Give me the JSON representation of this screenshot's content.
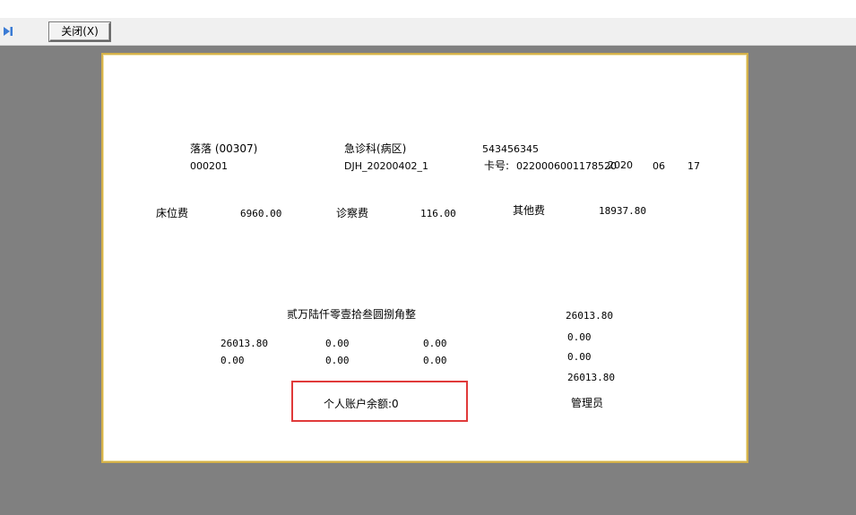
{
  "toolbar": {
    "close_label": "关闭(X)"
  },
  "patient": {
    "name": "落落 (00307)",
    "department": "急诊科(病区)",
    "card_id": "543456345",
    "code": "000201",
    "record_no": "DJH_20200402_1",
    "card_label": "卡号:",
    "card_no": "0220006001178520",
    "date_year": "2020",
    "date_month": "06",
    "date_day": "17"
  },
  "fees": {
    "bed_label": "床位费",
    "bed_value": "6960.00",
    "exam_label": "诊察费",
    "exam_value": "116.00",
    "other_label": "其他费",
    "other_value": "18937.80"
  },
  "summary": {
    "amount_words": "贰万陆仟零壹拾叁圆捌角整",
    "total": "26013.80",
    "row1": [
      "26013.80",
      "0.00",
      "0.00"
    ],
    "row2": [
      "0.00",
      "0.00",
      "0.00"
    ],
    "side_values": [
      "0.00",
      "0.00",
      "26013.80"
    ],
    "balance": "个人账户余额:0",
    "operator": "管理员"
  }
}
